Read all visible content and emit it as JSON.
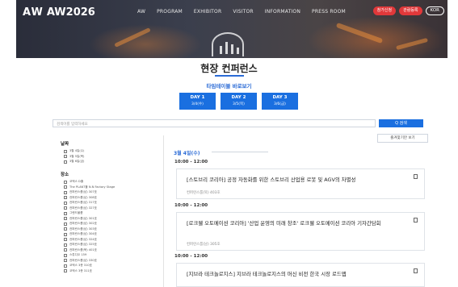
{
  "header": {
    "logo_mark": "AW",
    "logo_name": "AW2026",
    "nav": [
      "AW",
      "PROGRAM",
      "EXHIBITOR",
      "VISITOR",
      "INFORMATION",
      "PRESS ROOM"
    ],
    "buttons": [
      "참가신청",
      "관람등록",
      "KOR"
    ]
  },
  "page_title": "현장 컨퍼런스",
  "timetable_link": "타임테이블 바로보기",
  "days": [
    {
      "label": "DAY 1",
      "date": "3/4(수)"
    },
    {
      "label": "DAY 2",
      "date": "3/5(목)"
    },
    {
      "label": "DAY 3",
      "date": "3/6(금)"
    }
  ],
  "search": {
    "placeholder": "검색어를 입력하세요",
    "button": "Q 검색"
  },
  "filters": {
    "date_heading": "날짜",
    "dates": [
      "3월 4일(수)",
      "3월 5일(목)",
      "3월 6일(금)"
    ],
    "place_heading": "장소",
    "places": [
      "코엑스 D홀",
      "The PLANT홀 N.N Factory Stage",
      "컨퍼런스룸(남) 307호",
      "컨퍼런스룸(남) 308호",
      "컨퍼런스룸(남) 317호",
      "컨퍼런스룸(남) 327호",
      "그랜드볼룸",
      "컨퍼런스룸(남) 301호",
      "컨퍼런스룸(남) 302호",
      "컨퍼런스룸(남) 303호",
      "컨퍼런스룸(남) 304호",
      "컨퍼런스룸(남) 324호",
      "컨퍼런스룸(남) 325호",
      "컨퍼런스룸(북) 401호",
      "스튜디오 159",
      "컨퍼런스룸(남) 330호",
      "코엑스 3층 310호",
      "코엑스 3층 311호"
    ]
  },
  "content": {
    "favorites_button": "즐겨찾기만 보기",
    "date_label": "3월 4일(수)",
    "sessions": [
      {
        "time": "10:00 - 12:00",
        "title": "[스토브리 코리아] 공정 자동화를 위한 스토브리 산업용 로봇 및 AGV의 차별성",
        "room": "컨퍼런스룸(북) 403호"
      },
      {
        "time": "10:00 - 12:00",
        "title": "[로크웰 오토메이션 코리아] '산업 운영의 미래 창조' 로크웰 오토메이션 코리아 기자간담회",
        "room": "컨퍼런스룸(남) 305호"
      },
      {
        "time": "10:00 - 12:00",
        "title": "[지브라 테크놀로지스] 지브라 테크놀로지스의 머신 비전 한국 시장 로드맵",
        "room": ""
      }
    ]
  },
  "colors": {
    "accent": "#1a6fe0",
    "red": "#e0383a"
  }
}
